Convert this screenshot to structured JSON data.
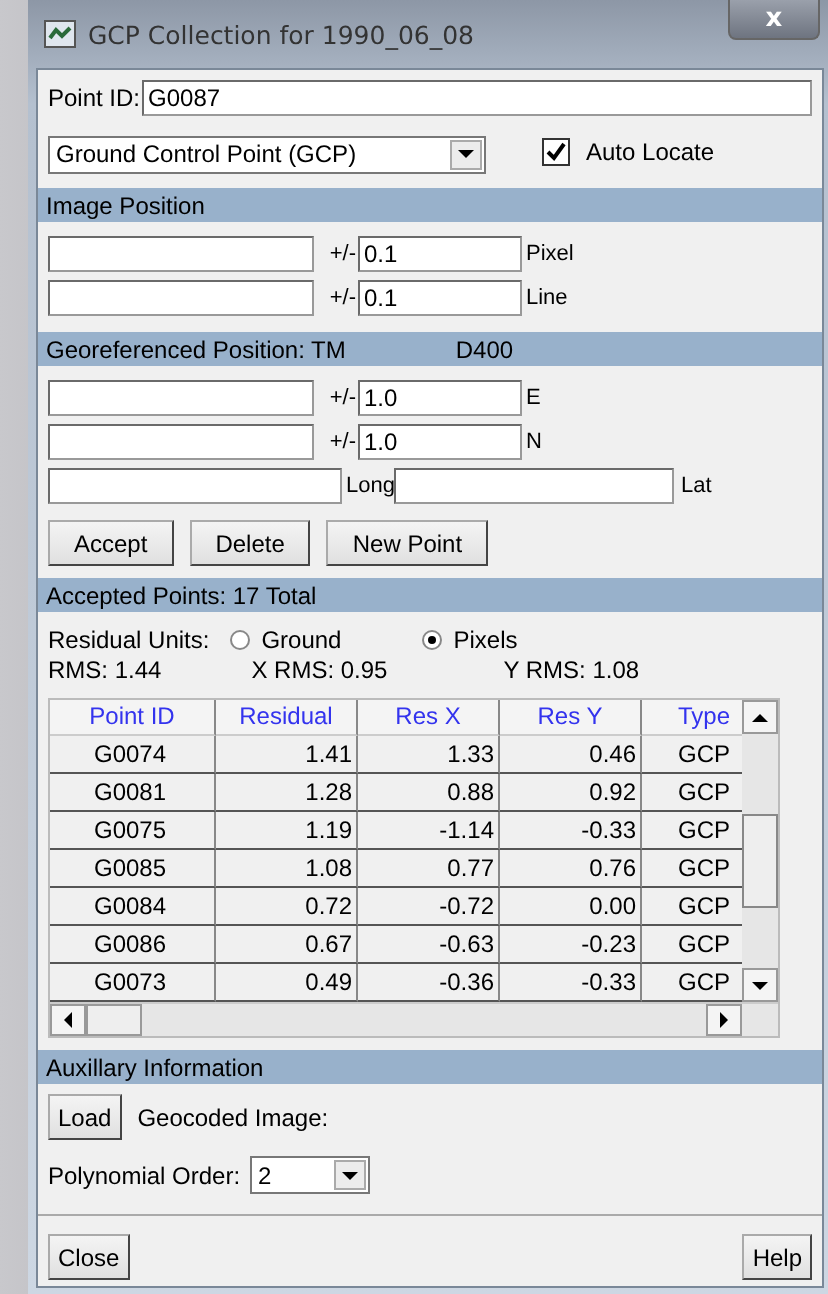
{
  "window": {
    "title": "GCP Collection for 1990_06_08",
    "close": "x"
  },
  "point_id": {
    "label": "Point ID:",
    "value": "G0087"
  },
  "point_type": {
    "value": "Ground Control Point (GCP)"
  },
  "auto_locate": {
    "label": "Auto Locate",
    "checked": true
  },
  "image_position": {
    "title": "Image Position",
    "rows": [
      {
        "value": "",
        "pm": "+/-",
        "tolerance": "0.1",
        "unit": "Pixel"
      },
      {
        "value": "",
        "pm": "+/-",
        "tolerance": "0.1",
        "unit": "Line"
      }
    ]
  },
  "georeferenced": {
    "title": "Georeferenced Position: TM",
    "datum": "D400",
    "rows": [
      {
        "value": "",
        "pm": "+/-",
        "tolerance": "1.0",
        "unit": "E"
      },
      {
        "value": "",
        "pm": "+/-",
        "tolerance": "1.0",
        "unit": "N"
      }
    ],
    "long_label": "Long",
    "lat_label": "Lat"
  },
  "buttons": [
    "Accept",
    "Delete",
    "New Point"
  ],
  "accepted": {
    "title": "Accepted Points: 17 Total",
    "units_label": "Residual Units:",
    "units": [
      {
        "label": "Ground",
        "selected": false
      },
      {
        "label": "Pixels",
        "selected": true
      }
    ],
    "rms": "RMS: 1.44",
    "x_rms": "X RMS: 0.95",
    "y_rms": "Y RMS: 1.08"
  },
  "table": {
    "columns": [
      "Point ID",
      "Residual",
      "Res X",
      "Res Y",
      "Type"
    ],
    "rows": [
      [
        "G0074",
        "1.41",
        "1.33",
        "0.46",
        "GCP"
      ],
      [
        "G0081",
        "1.28",
        "0.88",
        "0.92",
        "GCP"
      ],
      [
        "G0075",
        "1.19",
        "-1.14",
        "-0.33",
        "GCP"
      ],
      [
        "G0085",
        "1.08",
        "0.77",
        "0.76",
        "GCP"
      ],
      [
        "G0084",
        "0.72",
        "-0.72",
        "0.00",
        "GCP"
      ],
      [
        "G0086",
        "0.67",
        "-0.63",
        "-0.23",
        "GCP"
      ],
      [
        "G0073",
        "0.49",
        "-0.36",
        "-0.33",
        "GCP"
      ]
    ]
  },
  "auxiliary": {
    "title": "Auxillary Information",
    "load": "Load",
    "geocoded_label": "Geocoded Image:",
    "order_label": "Polynomial Order:",
    "order_value": "2"
  },
  "footer": {
    "close": "Close",
    "help": "Help"
  }
}
